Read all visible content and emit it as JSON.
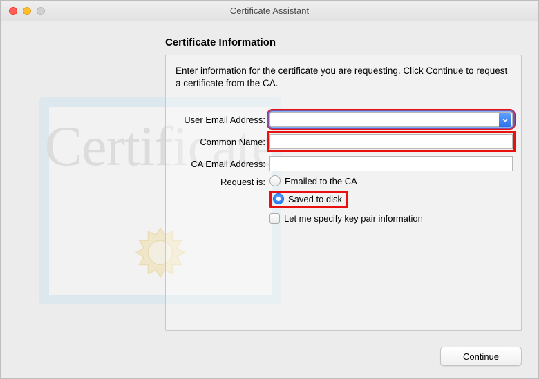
{
  "window": {
    "title": "Certificate Assistant"
  },
  "heading": "Certificate Information",
  "instruction": "Enter information for the certificate you are requesting. Click Continue to request a certificate from the CA.",
  "form": {
    "user_email_label": "User Email Address:",
    "user_email_value": "",
    "common_name_label": "Common Name:",
    "common_name_value": "",
    "ca_email_label": "CA Email Address:",
    "ca_email_value": "",
    "request_is_label": "Request is:",
    "radio_emailed": "Emailed to the CA",
    "radio_saved": "Saved to disk",
    "radio_selected": "saved",
    "keypair_checkbox_label": "Let me specify key pair information",
    "keypair_checked": false
  },
  "buttons": {
    "continue": "Continue"
  },
  "deco_word": "Certificate"
}
